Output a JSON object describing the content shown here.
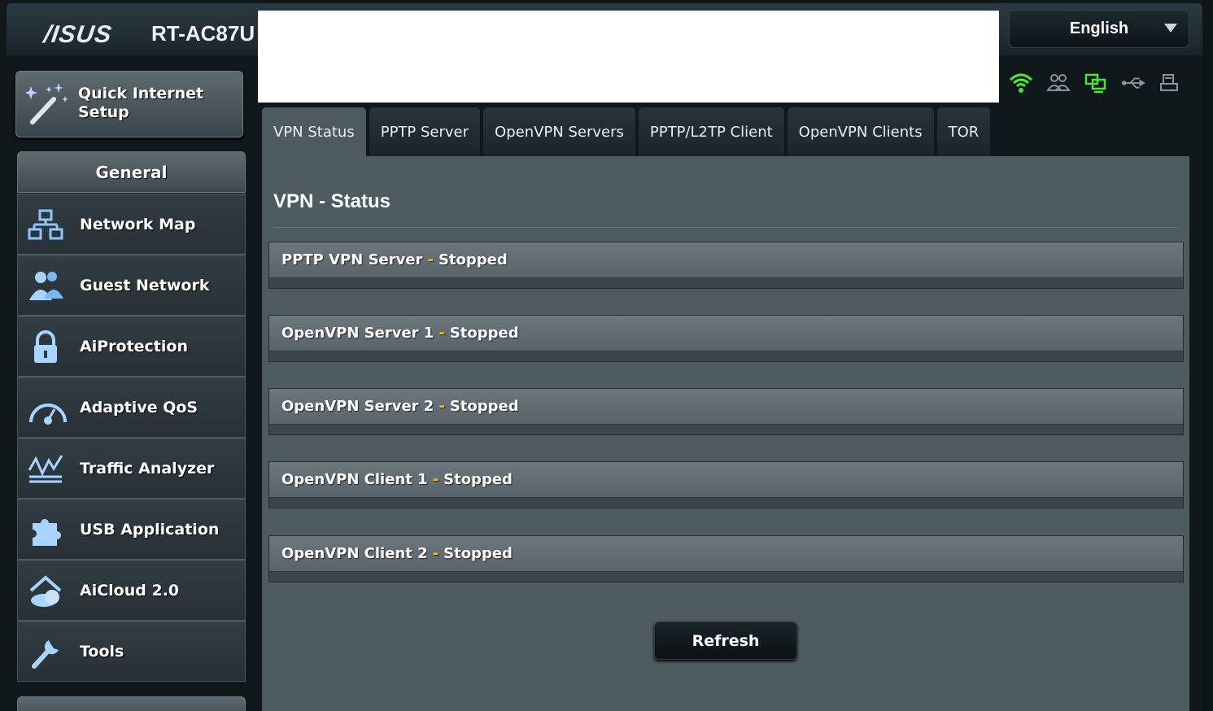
{
  "header": {
    "brand": "/ISUS",
    "model": "RT-AC87U",
    "language": "English"
  },
  "status_icons": [
    "wifi-icon",
    "clients-icon",
    "network-icon",
    "usb-icon",
    "printer-icon"
  ],
  "colors": {
    "wifi_active": "#55e03b",
    "accent_separator": "#ffc000",
    "panel_bg": "#4d5a60"
  },
  "sidebar": {
    "quick_setup": "Quick Internet Setup",
    "section_title": "General",
    "items": [
      {
        "label": "Network Map",
        "icon": "network-map-icon"
      },
      {
        "label": "Guest Network",
        "icon": "guest-network-icon"
      },
      {
        "label": "AiProtection",
        "icon": "lock-icon"
      },
      {
        "label": "Adaptive QoS",
        "icon": "gauge-icon"
      },
      {
        "label": "Traffic Analyzer",
        "icon": "analyzer-icon"
      },
      {
        "label": "USB Application",
        "icon": "puzzle-icon"
      },
      {
        "label": "AiCloud 2.0",
        "icon": "cloud-house-icon"
      },
      {
        "label": "Tools",
        "icon": "wrench-icon"
      }
    ]
  },
  "tabs": [
    {
      "label": "VPN Status",
      "active": true
    },
    {
      "label": "PPTP Server",
      "active": false
    },
    {
      "label": "OpenVPN Servers",
      "active": false
    },
    {
      "label": "PPTP/L2TP Client",
      "active": false
    },
    {
      "label": "OpenVPN Clients",
      "active": false
    },
    {
      "label": "TOR",
      "active": false
    }
  ],
  "main": {
    "title": "VPN - Status",
    "separator": "-",
    "sections": [
      {
        "name": "PPTP VPN Server",
        "state": "Stopped"
      },
      {
        "name": "OpenVPN Server 1",
        "state": "Stopped"
      },
      {
        "name": "OpenVPN Server 2",
        "state": "Stopped"
      },
      {
        "name": "OpenVPN Client 1",
        "state": "Stopped"
      },
      {
        "name": "OpenVPN Client 2",
        "state": "Stopped"
      }
    ],
    "refresh_label": "Refresh"
  }
}
